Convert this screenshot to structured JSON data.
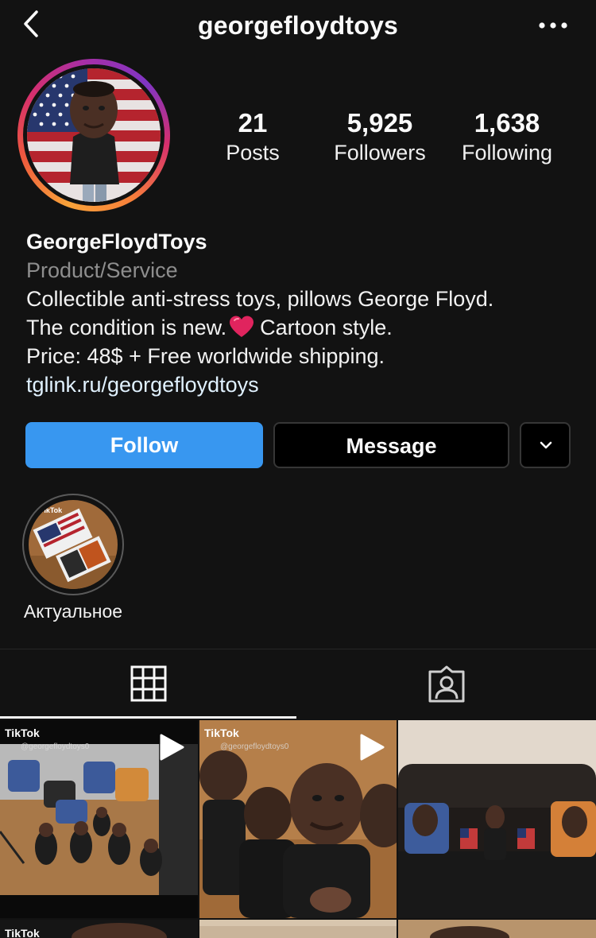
{
  "header": {
    "username": "georgefloydtoys",
    "back_icon": "chevron-left-icon",
    "more_icon": "more-horizontal-icon"
  },
  "stats": {
    "posts": {
      "count": "21",
      "label": "Posts"
    },
    "followers": {
      "count": "5,925",
      "label": "Followers"
    },
    "following": {
      "count": "1,638",
      "label": "Following"
    }
  },
  "bio": {
    "name": "GeorgeFloydToys",
    "category": "Product/Service",
    "line1": "Collectible anti-stress toys, pillows George Floyd.",
    "line2_before": "The condition is new.",
    "line2_after": "Cartoon style.",
    "line3": "Price: 48$ + Free worldwide shipping.",
    "link": "tglink.ru/georgefloydtoys"
  },
  "actions": {
    "follow_label": "Follow",
    "message_label": "Message",
    "more_icon": "chevron-down-icon"
  },
  "highlights": [
    {
      "label": "Актуальное",
      "badge": "TikTok"
    }
  ],
  "tabs": {
    "grid_icon": "grid-icon",
    "tagged_icon": "tagged-user-icon",
    "active": "grid"
  },
  "posts": [
    {
      "badge": "TikTok",
      "sub": "@georgefloydtoys0",
      "type": "video"
    },
    {
      "badge": "TikTok",
      "sub": "@georgefloydtoys0",
      "type": "video"
    },
    {
      "badge": "",
      "sub": "",
      "type": "photo"
    },
    {
      "badge": "TikTok",
      "sub": "",
      "type": "video"
    },
    {
      "badge": "",
      "sub": "",
      "type": "video"
    },
    {
      "badge": "",
      "sub": "",
      "type": "video"
    }
  ],
  "colors": {
    "background": "#121212",
    "follow_button": "#3897f0",
    "secondary_text": "#8e8e8e",
    "link_text": "#e0f1ff",
    "heart": "#e0245e"
  }
}
